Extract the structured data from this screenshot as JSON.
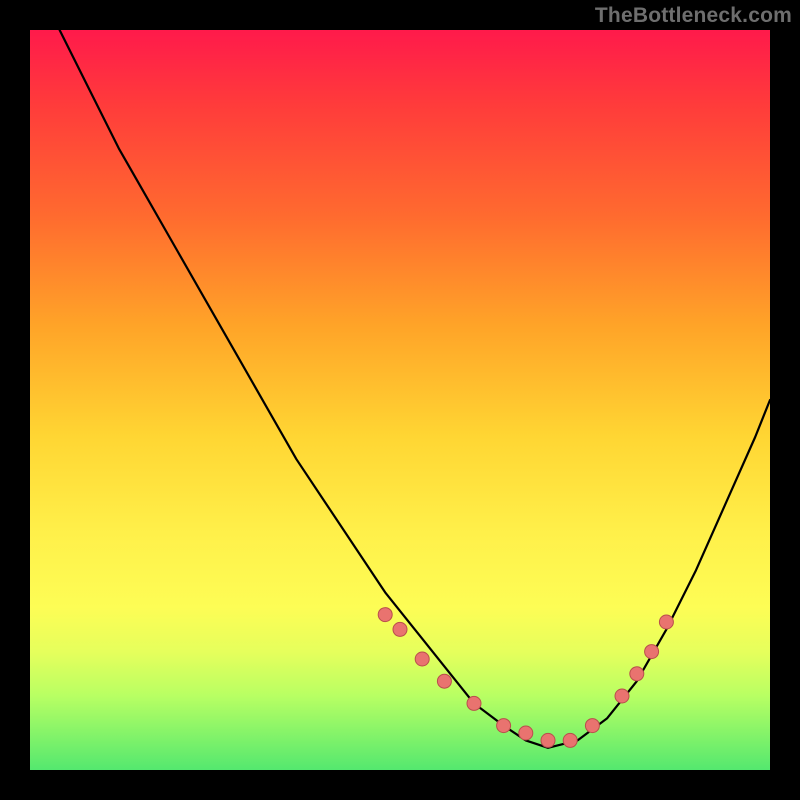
{
  "watermark": "TheBottleneck.com",
  "colors": {
    "page_bg": "#000000",
    "gradient_stops": [
      "#ff1a4b",
      "#ff3b3b",
      "#ff6a2f",
      "#ffa428",
      "#ffd633",
      "#fff04a",
      "#fdfd55",
      "#e6ff5c",
      "#b8ff63",
      "#54e86f"
    ],
    "curve": "#000000",
    "marker_fill": "#e9736f",
    "marker_stroke": "#b94f4c"
  },
  "chart_data": {
    "type": "line",
    "title": "",
    "xlabel": "",
    "ylabel": "",
    "xlim": [
      0,
      100
    ],
    "ylim": [
      0,
      100
    ],
    "grid": false,
    "legend": false,
    "series": [
      {
        "name": "curve",
        "x": [
          4,
          8,
          12,
          16,
          20,
          24,
          28,
          32,
          36,
          40,
          44,
          48,
          52,
          56,
          60,
          64,
          67,
          70,
          74,
          78,
          82,
          86,
          90,
          94,
          98,
          100
        ],
        "y": [
          100,
          92,
          84,
          77,
          70,
          63,
          56,
          49,
          42,
          36,
          30,
          24,
          19,
          14,
          9,
          6,
          4,
          3,
          4,
          7,
          12,
          19,
          27,
          36,
          45,
          50
        ]
      }
    ],
    "markers": {
      "name": "highlighted-points",
      "x": [
        48,
        50,
        53,
        56,
        60,
        64,
        67,
        70,
        73,
        76,
        80,
        82,
        84,
        86
      ],
      "y": [
        21,
        19,
        15,
        12,
        9,
        6,
        5,
        4,
        4,
        6,
        10,
        13,
        16,
        20
      ]
    }
  }
}
